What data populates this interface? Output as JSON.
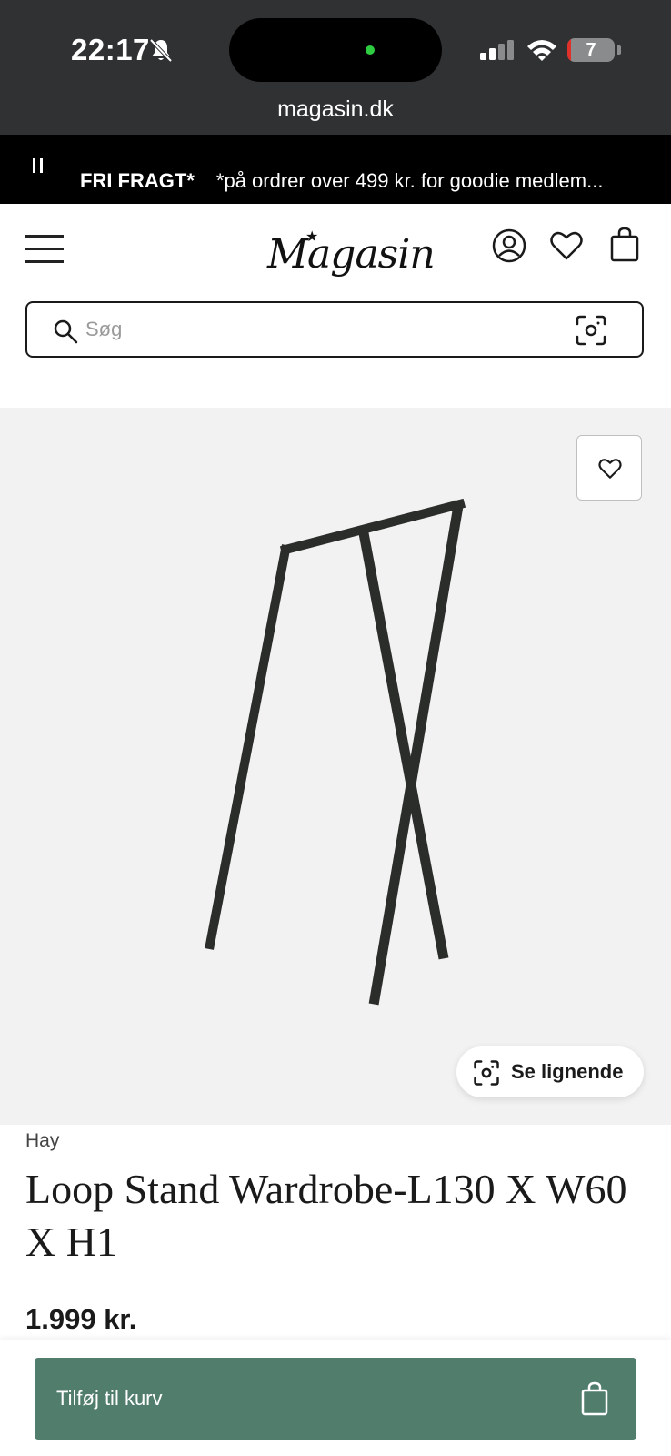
{
  "status_bar": {
    "time": "22:17",
    "battery": "7",
    "url": "magasin.dk"
  },
  "promo": {
    "bold": "FRI FRAGT*",
    "text": "*på ordrer over 499 kr. for goodie medlem..."
  },
  "header": {
    "logo": "Magasin",
    "search_placeholder": "Søg"
  },
  "product": {
    "brand": "Hay",
    "title": "Loop Stand Wardrobe-L130 X W60 X H1",
    "price": "1.999 kr.",
    "similar_label": "Se lignende",
    "add_to_cart_label": "Tilføj til kurv"
  },
  "colors": {
    "accent": "#517d6c",
    "promo_bg": "#000000",
    "status_bg": "#2f3133",
    "image_bg": "#f2f2f2"
  },
  "icons": [
    "bell-off-icon",
    "signal-icon",
    "wifi-icon",
    "battery-icon",
    "pause-icon",
    "menu-icon",
    "account-icon",
    "heart-icon",
    "shopping-bag-icon",
    "search-icon",
    "camera-search-icon"
  ]
}
